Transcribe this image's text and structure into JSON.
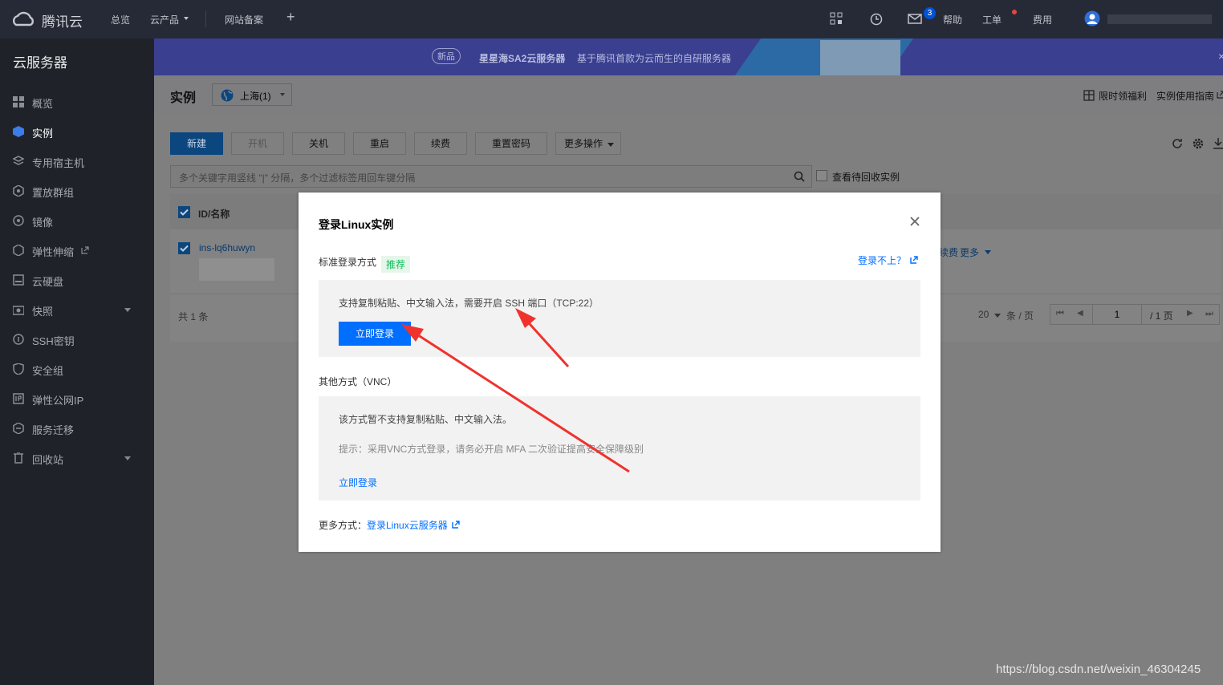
{
  "topnav": {
    "brand": "腾讯云",
    "items": [
      "总览",
      "云产品",
      "网站备案"
    ],
    "right": [
      "帮助",
      "工单",
      "费用"
    ],
    "mail_count": "3"
  },
  "sidebar": {
    "title": "云服务器",
    "items": [
      {
        "label": "概览",
        "icon": "grid-icon"
      },
      {
        "label": "实例",
        "icon": "cube-icon"
      },
      {
        "label": "专用宿主机",
        "icon": "layers-icon"
      },
      {
        "label": "置放群组",
        "icon": "group-icon"
      },
      {
        "label": "镜像",
        "icon": "disc-icon"
      },
      {
        "label": "弹性伸缩",
        "icon": "scale-icon"
      },
      {
        "label": "云硬盘",
        "icon": "disk-icon"
      },
      {
        "label": "快照",
        "icon": "camera-icon"
      },
      {
        "label": "SSH密钥",
        "icon": "key-icon"
      },
      {
        "label": "安全组",
        "icon": "shield-icon"
      },
      {
        "label": "弹性公网IP",
        "icon": "ip-icon"
      },
      {
        "label": "服务迁移",
        "icon": "migrate-icon"
      },
      {
        "label": "回收站",
        "icon": "trash-icon"
      }
    ]
  },
  "banner": {
    "badge": "新品",
    "product": "星星海SA2云服务器",
    "desc": "基于腾讯首款为云而生的自研服务器"
  },
  "subheader": {
    "title": "实例",
    "region": "上海(1)",
    "right_links": [
      "限时领福利",
      "实例使用指南"
    ]
  },
  "toolbar": {
    "buttons": [
      "新建",
      "开机",
      "关机",
      "重启",
      "续费",
      "重置密码",
      "更多操作"
    ],
    "search_placeholder": "多个关键字用竖线 \"|\" 分隔，多个过滤标签用回车键分隔",
    "recycle_label": "查看待回收实例"
  },
  "table": {
    "header_id": "ID/名称",
    "row_id": "ins-lq6huwyn",
    "row_actions": [
      "续费",
      "更多"
    ],
    "total": "共 1 条",
    "page_size": "20",
    "per_page": "条 / 页",
    "page": "1",
    "page_total": "/ 1 页"
  },
  "modal": {
    "title": "登录Linux实例",
    "standard_label": "标准登录方式",
    "recommend_tag": "推荐",
    "cant_login": "登录不上？",
    "standard_desc": "支持复制粘贴、中文输入法，需要开启 SSH 端口（TCP:22）",
    "login_now": "立即登录",
    "other_label": "其他方式（VNC）",
    "vnc_desc": "该方式暂不支持复制粘贴、中文输入法。",
    "vnc_tip": "提示：采用VNC方式登录，请务必开启 MFA 二次验证提高安全保障级别",
    "vnc_login": "立即登录",
    "more_label": "更多方式：",
    "more_link": "登录Linux云服务器"
  },
  "watermark": "https://blog.csdn.net/weixin_46304245"
}
